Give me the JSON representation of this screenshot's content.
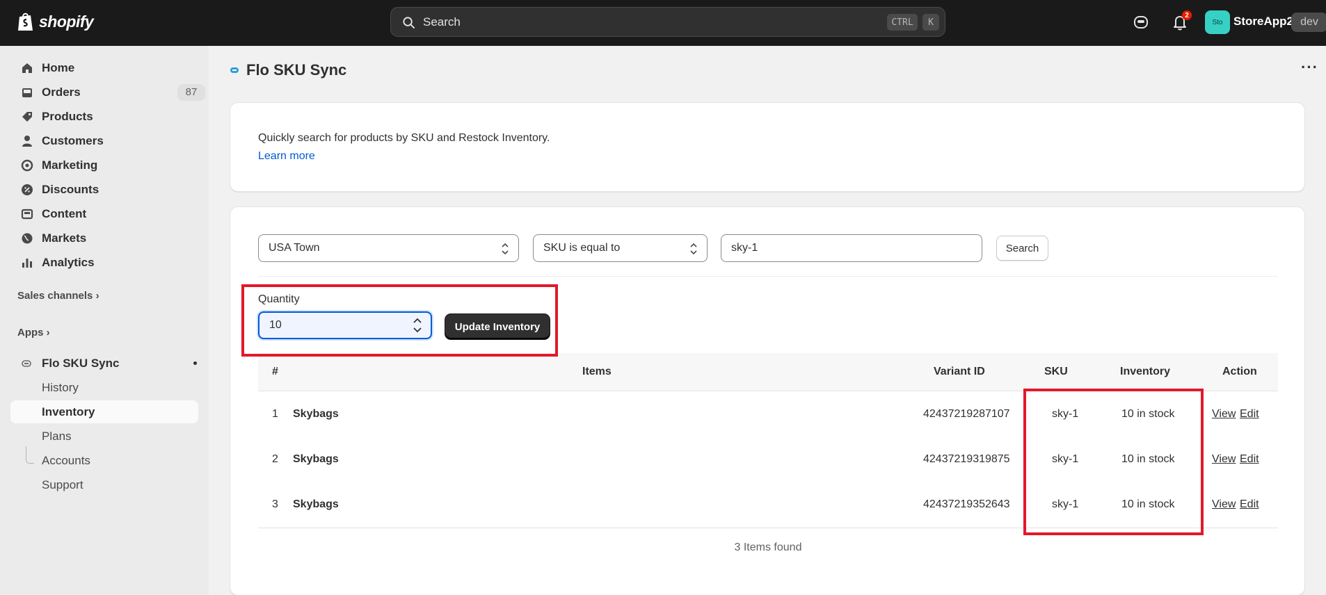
{
  "topbar": {
    "logo_text": "shopify",
    "search_placeholder": "Search",
    "shortcut_ctrl": "CTRL",
    "shortcut_k": "K",
    "notification_count": "2",
    "store_avatar": "Sto",
    "store_name": "StoreApp2",
    "store_badge": "dev"
  },
  "sidebar": {
    "items": [
      {
        "label": "Home",
        "icon": "home-icon"
      },
      {
        "label": "Orders",
        "icon": "inbox-icon",
        "badge": "87"
      },
      {
        "label": "Products",
        "icon": "tag-icon"
      },
      {
        "label": "Customers",
        "icon": "person-icon"
      },
      {
        "label": "Marketing",
        "icon": "target-icon"
      },
      {
        "label": "Discounts",
        "icon": "discount-icon"
      },
      {
        "label": "Content",
        "icon": "content-icon"
      },
      {
        "label": "Markets",
        "icon": "globe-icon"
      },
      {
        "label": "Analytics",
        "icon": "bar-chart-icon"
      }
    ],
    "sales_channels": "Sales channels",
    "apps": "Apps",
    "app_name": "Flo SKU Sync",
    "app_subitems": [
      "History",
      "Inventory",
      "Plans",
      "Accounts",
      "Support"
    ]
  },
  "page": {
    "title": "Flo SKU Sync",
    "intro": "Quickly search for products by SKU and Restock Inventory.",
    "learn_more": "Learn more"
  },
  "filters": {
    "location": "USA Town",
    "condition": "SKU is equal to",
    "query": "sky-1",
    "search_button": "Search"
  },
  "quantity": {
    "label": "Quantity",
    "value": "10",
    "update_button": "Update Inventory"
  },
  "table": {
    "headers": [
      "#",
      "Items",
      "Variant ID",
      "SKU",
      "Inventory",
      "Action"
    ],
    "rows": [
      {
        "num": "1",
        "item": "Skybags",
        "variant": "42437219287107",
        "sku": "sky-1",
        "inventory": "10 in stock",
        "view": "View",
        "edit": "Edit"
      },
      {
        "num": "2",
        "item": "Skybags",
        "variant": "42437219319875",
        "sku": "sky-1",
        "inventory": "10 in stock",
        "view": "View",
        "edit": "Edit"
      },
      {
        "num": "3",
        "item": "Skybags",
        "variant": "42437219352643",
        "sku": "sky-1",
        "inventory": "10 in stock",
        "view": "View",
        "edit": "Edit"
      }
    ],
    "footer": "3 Items found"
  },
  "colors": {
    "highlight": "#e1192a",
    "link": "#005bd3",
    "topbar": "#1a1a1a"
  }
}
